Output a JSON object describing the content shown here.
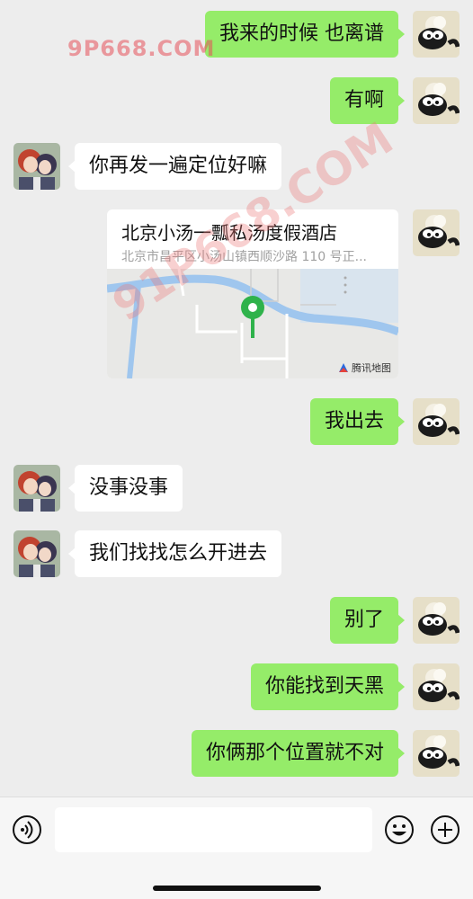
{
  "watermark": {
    "site": "9P668.COM",
    "diag": "91P668.COM"
  },
  "messages": [
    {
      "side": "me",
      "text": "我来的时候 也离谱"
    },
    {
      "side": "me",
      "text": "有啊"
    },
    {
      "side": "them",
      "text": "你再发一遍定位好嘛"
    },
    {
      "side": "me",
      "type": "location",
      "title": "北京小汤一瓢私汤度假酒店",
      "address": "北京市昌平区小汤山镇西顺沙路 110 号正...",
      "map_brand": "腾讯地图"
    },
    {
      "side": "me",
      "text": "我出去"
    },
    {
      "side": "them",
      "text": "没事没事"
    },
    {
      "side": "them",
      "text": "我们找找怎么开进去"
    },
    {
      "side": "me",
      "text": "别了"
    },
    {
      "side": "me",
      "text": "你能找到天黑"
    },
    {
      "side": "me",
      "text": "你俩那个位置就不对"
    }
  ],
  "input": {
    "value": "",
    "placeholder": ""
  },
  "icons": {
    "voice": "voice-icon",
    "emoji": "emoji-icon",
    "plus": "plus-icon"
  },
  "colors": {
    "me_bubble": "#95ec69",
    "them_bubble": "#ffffff",
    "background": "#ededed",
    "map_pin": "#2fb24b"
  }
}
